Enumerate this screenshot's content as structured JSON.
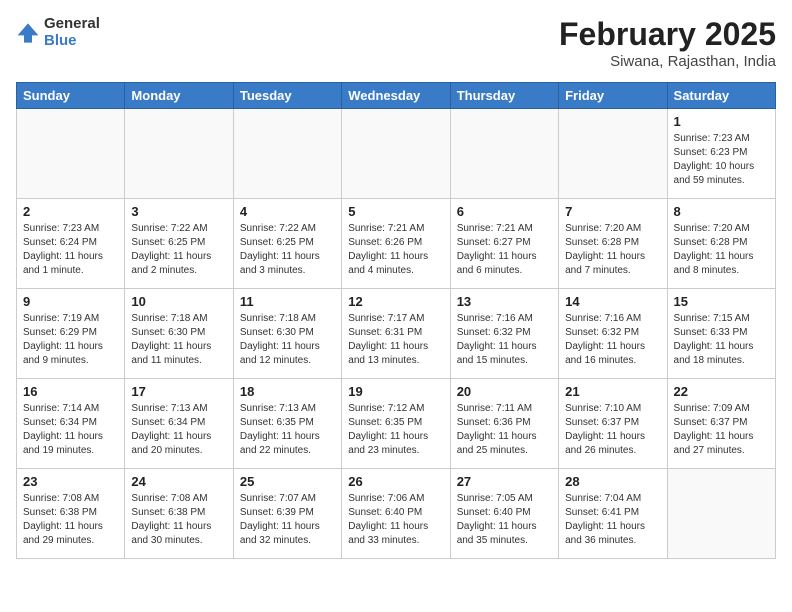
{
  "logo": {
    "general": "General",
    "blue": "Blue"
  },
  "header": {
    "title": "February 2025",
    "subtitle": "Siwana, Rajasthan, India"
  },
  "weekdays": [
    "Sunday",
    "Monday",
    "Tuesday",
    "Wednesday",
    "Thursday",
    "Friday",
    "Saturday"
  ],
  "weeks": [
    [
      {
        "day": "",
        "info": ""
      },
      {
        "day": "",
        "info": ""
      },
      {
        "day": "",
        "info": ""
      },
      {
        "day": "",
        "info": ""
      },
      {
        "day": "",
        "info": ""
      },
      {
        "day": "",
        "info": ""
      },
      {
        "day": "1",
        "info": "Sunrise: 7:23 AM\nSunset: 6:23 PM\nDaylight: 10 hours\nand 59 minutes."
      }
    ],
    [
      {
        "day": "2",
        "info": "Sunrise: 7:23 AM\nSunset: 6:24 PM\nDaylight: 11 hours\nand 1 minute."
      },
      {
        "day": "3",
        "info": "Sunrise: 7:22 AM\nSunset: 6:25 PM\nDaylight: 11 hours\nand 2 minutes."
      },
      {
        "day": "4",
        "info": "Sunrise: 7:22 AM\nSunset: 6:25 PM\nDaylight: 11 hours\nand 3 minutes."
      },
      {
        "day": "5",
        "info": "Sunrise: 7:21 AM\nSunset: 6:26 PM\nDaylight: 11 hours\nand 4 minutes."
      },
      {
        "day": "6",
        "info": "Sunrise: 7:21 AM\nSunset: 6:27 PM\nDaylight: 11 hours\nand 6 minutes."
      },
      {
        "day": "7",
        "info": "Sunrise: 7:20 AM\nSunset: 6:28 PM\nDaylight: 11 hours\nand 7 minutes."
      },
      {
        "day": "8",
        "info": "Sunrise: 7:20 AM\nSunset: 6:28 PM\nDaylight: 11 hours\nand 8 minutes."
      }
    ],
    [
      {
        "day": "9",
        "info": "Sunrise: 7:19 AM\nSunset: 6:29 PM\nDaylight: 11 hours\nand 9 minutes."
      },
      {
        "day": "10",
        "info": "Sunrise: 7:18 AM\nSunset: 6:30 PM\nDaylight: 11 hours\nand 11 minutes."
      },
      {
        "day": "11",
        "info": "Sunrise: 7:18 AM\nSunset: 6:30 PM\nDaylight: 11 hours\nand 12 minutes."
      },
      {
        "day": "12",
        "info": "Sunrise: 7:17 AM\nSunset: 6:31 PM\nDaylight: 11 hours\nand 13 minutes."
      },
      {
        "day": "13",
        "info": "Sunrise: 7:16 AM\nSunset: 6:32 PM\nDaylight: 11 hours\nand 15 minutes."
      },
      {
        "day": "14",
        "info": "Sunrise: 7:16 AM\nSunset: 6:32 PM\nDaylight: 11 hours\nand 16 minutes."
      },
      {
        "day": "15",
        "info": "Sunrise: 7:15 AM\nSunset: 6:33 PM\nDaylight: 11 hours\nand 18 minutes."
      }
    ],
    [
      {
        "day": "16",
        "info": "Sunrise: 7:14 AM\nSunset: 6:34 PM\nDaylight: 11 hours\nand 19 minutes."
      },
      {
        "day": "17",
        "info": "Sunrise: 7:13 AM\nSunset: 6:34 PM\nDaylight: 11 hours\nand 20 minutes."
      },
      {
        "day": "18",
        "info": "Sunrise: 7:13 AM\nSunset: 6:35 PM\nDaylight: 11 hours\nand 22 minutes."
      },
      {
        "day": "19",
        "info": "Sunrise: 7:12 AM\nSunset: 6:35 PM\nDaylight: 11 hours\nand 23 minutes."
      },
      {
        "day": "20",
        "info": "Sunrise: 7:11 AM\nSunset: 6:36 PM\nDaylight: 11 hours\nand 25 minutes."
      },
      {
        "day": "21",
        "info": "Sunrise: 7:10 AM\nSunset: 6:37 PM\nDaylight: 11 hours\nand 26 minutes."
      },
      {
        "day": "22",
        "info": "Sunrise: 7:09 AM\nSunset: 6:37 PM\nDaylight: 11 hours\nand 27 minutes."
      }
    ],
    [
      {
        "day": "23",
        "info": "Sunrise: 7:08 AM\nSunset: 6:38 PM\nDaylight: 11 hours\nand 29 minutes."
      },
      {
        "day": "24",
        "info": "Sunrise: 7:08 AM\nSunset: 6:38 PM\nDaylight: 11 hours\nand 30 minutes."
      },
      {
        "day": "25",
        "info": "Sunrise: 7:07 AM\nSunset: 6:39 PM\nDaylight: 11 hours\nand 32 minutes."
      },
      {
        "day": "26",
        "info": "Sunrise: 7:06 AM\nSunset: 6:40 PM\nDaylight: 11 hours\nand 33 minutes."
      },
      {
        "day": "27",
        "info": "Sunrise: 7:05 AM\nSunset: 6:40 PM\nDaylight: 11 hours\nand 35 minutes."
      },
      {
        "day": "28",
        "info": "Sunrise: 7:04 AM\nSunset: 6:41 PM\nDaylight: 11 hours\nand 36 minutes."
      },
      {
        "day": "",
        "info": ""
      }
    ]
  ]
}
